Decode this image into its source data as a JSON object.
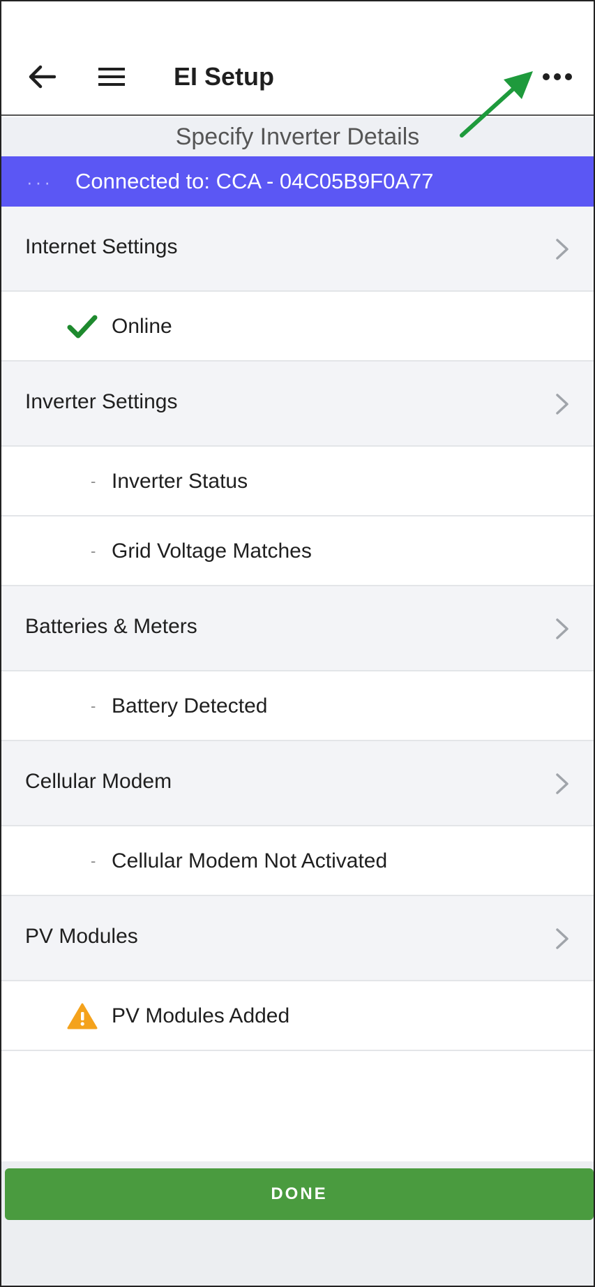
{
  "header": {
    "title": "EI Setup",
    "back_icon": "arrow-left-icon",
    "menu_icon": "hamburger-icon",
    "more_icon": "more-horizontal-icon"
  },
  "subtitle": "Specify Inverter Details",
  "connection": {
    "dots": "···",
    "text": "Connected to: CCA - 04C05B9F0A77",
    "color": "#5b57f4"
  },
  "sections": [
    {
      "label": "Internet Settings",
      "items": [
        {
          "label": "Online",
          "icon": "check-icon"
        }
      ]
    },
    {
      "label": "Inverter Settings",
      "items": [
        {
          "label": "Inverter Status",
          "bullet": "-"
        },
        {
          "label": "Grid Voltage Matches",
          "bullet": "-"
        }
      ]
    },
    {
      "label": "Batteries & Meters",
      "items": [
        {
          "label": "Battery Detected",
          "bullet": "-"
        }
      ]
    },
    {
      "label": "Cellular Modem",
      "items": [
        {
          "label": "Cellular Modem Not Activated",
          "bullet": "-"
        }
      ]
    },
    {
      "label": "PV Modules",
      "items": [
        {
          "label": "PV Modules Added",
          "icon": "warning-icon"
        }
      ]
    }
  ],
  "footer": {
    "done_label": "DONE",
    "done_color": "#4a9b3f"
  },
  "colors": {
    "check": "#1e8a2e",
    "warning": "#f4a21c",
    "hint_arrow": "#1e9a3c"
  }
}
